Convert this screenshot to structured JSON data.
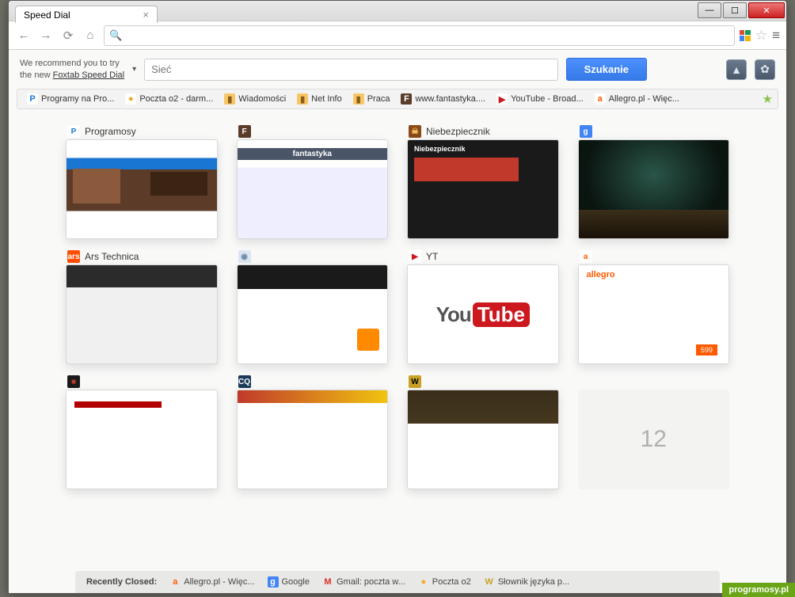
{
  "tab": {
    "title": "Speed Dial"
  },
  "recommend": {
    "line1": "We recommend you to try",
    "line2_prefix": "the new ",
    "link": "Foxtab Speed Dial"
  },
  "search": {
    "placeholder": "Sieć",
    "button": "Szukanie"
  },
  "bookmarks": [
    {
      "label": "Programy na Pro...",
      "iconBg": "#fff",
      "iconFg": "#1976d2",
      "iconText": "P"
    },
    {
      "label": "Poczta o2 - darm...",
      "iconBg": "#fff",
      "iconFg": "#f5a623",
      "iconText": "●"
    },
    {
      "label": "Wiadomości",
      "iconBg": "#f6c667",
      "iconFg": "#8a5e1a",
      "iconText": "▮"
    },
    {
      "label": "Net Info",
      "iconBg": "#f6c667",
      "iconFg": "#8a5e1a",
      "iconText": "▮"
    },
    {
      "label": "Praca",
      "iconBg": "#f6c667",
      "iconFg": "#8a5e1a",
      "iconText": "▮"
    },
    {
      "label": "www.fantastyka....",
      "iconBg": "#5a3c28",
      "iconFg": "#fff",
      "iconText": "F"
    },
    {
      "label": "YouTube - Broad...",
      "iconBg": "#fff",
      "iconFg": "#cc181e",
      "iconText": "▶"
    },
    {
      "label": "Allegro.pl - Więc...",
      "iconBg": "#fff",
      "iconFg": "#ff5a00",
      "iconText": "a"
    }
  ],
  "tiles": [
    {
      "label": "Programosy",
      "iconBg": "#fff",
      "iconFg": "#1976d2",
      "iconText": "P",
      "thumb": "t1"
    },
    {
      "label": "",
      "iconBg": "#5a3c28",
      "iconFg": "#fff",
      "iconText": "F",
      "thumb": "t2"
    },
    {
      "label": "Niebezpiecznik",
      "iconBg": "#8a4a1a",
      "iconFg": "#ffcc66",
      "iconText": "☠",
      "thumb": "t3"
    },
    {
      "label": "",
      "iconBg": "#4285f4",
      "iconFg": "#fff",
      "iconText": "g",
      "thumb": "t4"
    },
    {
      "label": "Ars Technica",
      "iconBg": "#ff4e00",
      "iconFg": "#fff",
      "iconText": "ars",
      "thumb": "t5"
    },
    {
      "label": "",
      "iconBg": "#dce6f0",
      "iconFg": "#6a8caa",
      "iconText": "◉",
      "thumb": "t6"
    },
    {
      "label": "YT",
      "iconBg": "#fff",
      "iconFg": "#cc181e",
      "iconText": "▶",
      "thumb": "t7"
    },
    {
      "label": "",
      "iconBg": "#fff",
      "iconFg": "#ff5a00",
      "iconText": "a",
      "thumb": "t8"
    },
    {
      "label": "",
      "iconBg": "#1a1a1a",
      "iconFg": "#c0392b",
      "iconText": "■",
      "thumb": "t9"
    },
    {
      "label": "",
      "iconBg": "#1a3a5a",
      "iconFg": "#fff",
      "iconText": "CQ",
      "thumb": "t10"
    },
    {
      "label": "",
      "iconBg": "#c9a227",
      "iconFg": "#000",
      "iconText": "W",
      "thumb": "t11"
    },
    {
      "label": "",
      "iconBg": "",
      "iconFg": "",
      "iconText": "",
      "thumb": "t12",
      "placeholder": "12"
    }
  ],
  "recent": {
    "label": "Recently Closed:",
    "items": [
      {
        "label": "Allegro.pl - Więc...",
        "iconFg": "#ff5a00",
        "iconText": "a"
      },
      {
        "label": "Google",
        "iconFg": "#4285f4",
        "iconText": "g",
        "iconBg": "#4285f4",
        "iconColor": "#fff"
      },
      {
        "label": "Gmail: poczta w...",
        "iconFg": "#d93025",
        "iconText": "M"
      },
      {
        "label": "Poczta o2",
        "iconFg": "#f5a623",
        "iconText": "●"
      },
      {
        "label": "Słownik języka p...",
        "iconFg": "#c9a227",
        "iconText": "W"
      }
    ]
  },
  "watermark": "programosy.pl"
}
